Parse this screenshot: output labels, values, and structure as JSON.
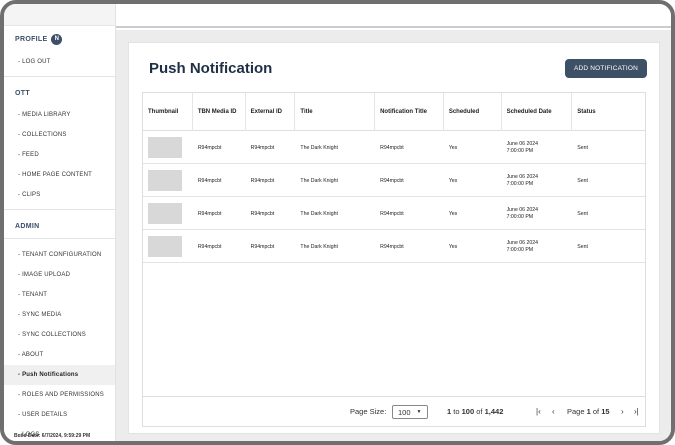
{
  "sidebar": {
    "profile_label": "PROFILE",
    "avatar_letter": "N",
    "logout": "- LOG OUT",
    "ott_label": "OTT",
    "ott_items": [
      "- MEDIA LIBRARY",
      "- COLLECTIONS",
      "- FEED",
      "- HOME PAGE CONTENT",
      "- CLIPS"
    ],
    "admin_label": "ADMIN",
    "admin_items": [
      "- TENANT CONFIGURATION",
      "- IMAGE UPLOAD",
      "- TENANT",
      "- SYNC MEDIA",
      "- SYNC COLLECTIONS",
      "- ABOUT",
      "- Push Notifications",
      "- ROLES AND PERMISSIONS",
      "- USER DETAILS",
      "- LOGS"
    ],
    "active_item": "- Push Notifications",
    "build_date": "Build Date: 6/7/2024, 9:59:29 PM"
  },
  "main": {
    "title": "Push Notification",
    "add_button": "ADD NOTIFICATION",
    "table": {
      "columns": [
        "Thumbnail",
        "TBN Media ID",
        "External ID",
        "Title",
        "Notification Title",
        "Scheduled",
        "Scheduled Date",
        "Status"
      ],
      "rows": [
        {
          "tbn_media_id": "R94mpcbt",
          "external_id": "R94mpcbt",
          "title": "The Dark Knight",
          "notification_title": "R94mpcbt",
          "scheduled": "Yes",
          "date_line1": "June 06 2024",
          "date_line2": "7:00:00 PM",
          "status": "Sent"
        },
        {
          "tbn_media_id": "R94mpcbt",
          "external_id": "R94mpcbt",
          "title": "The Dark Knight",
          "notification_title": "R94mpcbt",
          "scheduled": "Yes",
          "date_line1": "June 06 2024",
          "date_line2": "7:00:00 PM",
          "status": "Sent"
        },
        {
          "tbn_media_id": "R94mpcbt",
          "external_id": "R94mpcbt",
          "title": "The Dark Knight",
          "notification_title": "R94mpcbt",
          "scheduled": "Yes",
          "date_line1": "June 06 2024",
          "date_line2": "7:00:00 PM",
          "status": "Sent"
        },
        {
          "tbn_media_id": "R94mpcbt",
          "external_id": "R94mpcbt",
          "title": "The Dark Knight",
          "notification_title": "R94mpcbt",
          "scheduled": "Yes",
          "date_line1": "June 06 2024",
          "date_line2": "7:00:00 PM",
          "status": "Sent"
        }
      ]
    },
    "pagination": {
      "page_size_label": "Page Size:",
      "page_size": "100",
      "range_start": "1",
      "range_to": "to",
      "range_end": "100",
      "range_of": "of",
      "total": "1,442",
      "page_label": "Page",
      "current_page": "1",
      "page_of": "of",
      "total_pages": "15"
    }
  },
  "colors": {
    "accent": "#3d5066",
    "sidebar_heading": "#3c4f68",
    "background": "#ececec"
  },
  "icons": [
    "first-page-icon",
    "previous-page-icon",
    "next-page-icon",
    "last-page-icon",
    "dropdown-caret-icon"
  ]
}
